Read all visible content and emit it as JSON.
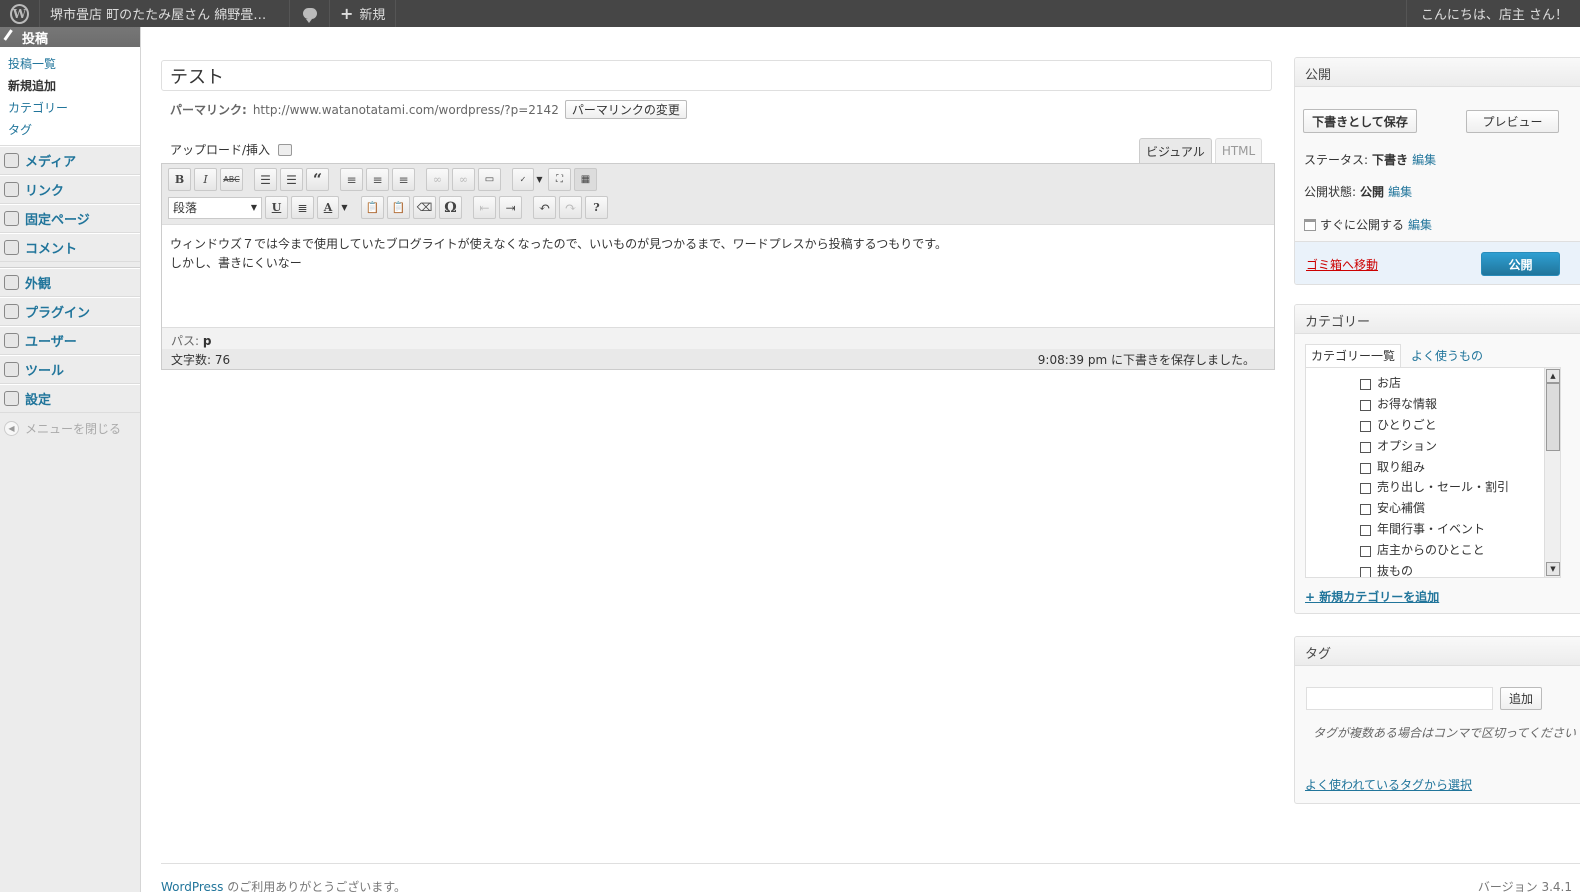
{
  "adminbar": {
    "site_name": "堺市畳店 町のたたみ屋さん 綿野畳店…",
    "new_label": "新規",
    "howdy": "こんにちは、店主 さん！"
  },
  "sidebar": {
    "posts_label": "投稿",
    "submenu": [
      "投稿一覧",
      "新規追加",
      "カテゴリー",
      "タグ"
    ],
    "items": [
      {
        "label": "メディア",
        "icon": "media-icon"
      },
      {
        "label": "リンク",
        "icon": "link-icon"
      },
      {
        "label": "固定ページ",
        "icon": "pages-icon"
      },
      {
        "label": "コメント",
        "icon": "comments-icon"
      }
    ],
    "items2": [
      {
        "label": "外観",
        "icon": "appearance-icon"
      },
      {
        "label": "プラグイン",
        "icon": "plugins-icon"
      },
      {
        "label": "ユーザー",
        "icon": "users-icon"
      },
      {
        "label": "ツール",
        "icon": "tools-icon"
      },
      {
        "label": "設定",
        "icon": "settings-icon"
      }
    ],
    "collapse_label": "メニューを閉じる"
  },
  "post": {
    "title": "テスト",
    "permalink_label": "パーマリンク:",
    "permalink_url": "http://www.watanotatami.com/wordpress/?p=2142",
    "permalink_change": "パーマリンクの変更",
    "upload_label": "アップロード/挿入"
  },
  "editor": {
    "tab_visual": "ビジュアル",
    "tab_html": "HTML",
    "format_value": "段落",
    "content_line1": "ウィンドウズ７では今まで使用していたブログライトが使えなくなったので、いいものが見つかるまで、ワードプレスから投稿するつもりです。",
    "content_line2": "しかし、書きにくいなー",
    "path_label": "パス:",
    "path_value": "p",
    "word_count": "文字数: 76",
    "autosave": "9:08:39 pm に下書きを保存しました。",
    "tb_bold": "B",
    "tb_italic": "I",
    "tb_strike": "ABC",
    "tb_quote": "“",
    "tb_underline": "U",
    "tb_color": "A",
    "tb_omega": "Ω",
    "tb_help": "?"
  },
  "publish": {
    "heading": "公開",
    "save_draft": "下書きとして保存",
    "preview": "プレビュー",
    "status_label": "ステータス:",
    "status_value": "下書き",
    "visibility_label": "公開状態:",
    "visibility_value": "公開",
    "schedule_label": "すぐに公開する",
    "edit": "編集",
    "trash": "ゴミ箱へ移動",
    "publish_button": "公開"
  },
  "categories": {
    "heading": "カテゴリー",
    "tab_all": "カテゴリー一覧",
    "tab_popular": "よく使うもの",
    "items": [
      "お店",
      "お得な情報",
      "ひとりごと",
      "オプション",
      "取り組み",
      "売り出し・セール・割引",
      "安心補償",
      "年間行事・イベント",
      "店主からのひとこと",
      "抜もの"
    ],
    "add_new": "+ 新規カテゴリーを追加"
  },
  "tags": {
    "heading": "タグ",
    "input_value": "",
    "add_button": "追加",
    "howto": "タグが複数ある場合はコンマで区切ってください",
    "cloud_link": "よく使われているタグから選択"
  },
  "footer": {
    "left_link": "WordPress",
    "left_text": " のご利用ありがとうございます。",
    "version": "バージョン 3.4.1"
  }
}
